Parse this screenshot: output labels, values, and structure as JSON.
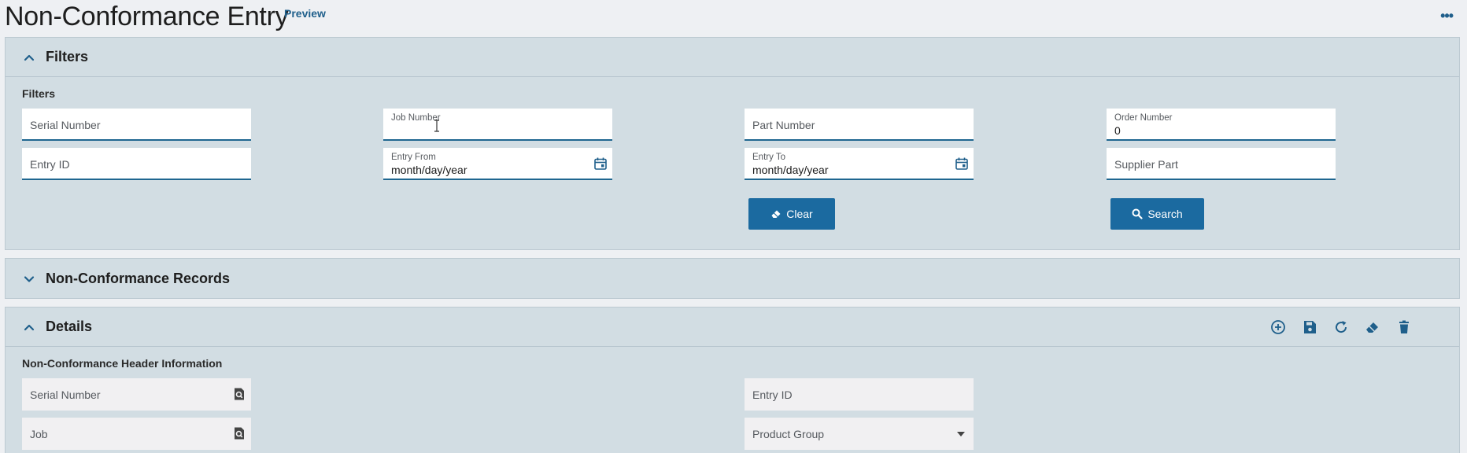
{
  "page": {
    "title": "Non-Conformance Entry",
    "preview_label": "Preview",
    "more_label": "•••"
  },
  "filters_panel": {
    "header": "Filters",
    "section_label": "Filters",
    "fields": {
      "serial_number": {
        "placeholder": "Serial Number"
      },
      "job_number": {
        "label": "Job Number",
        "value": ""
      },
      "part_number": {
        "placeholder": "Part Number"
      },
      "order_number": {
        "label": "Order Number",
        "value": "0"
      },
      "entry_id": {
        "placeholder": "Entry ID"
      },
      "entry_from": {
        "label": "Entry From",
        "value": "month/day/year"
      },
      "entry_to": {
        "label": "Entry To",
        "value": "month/day/year"
      },
      "supplier_part": {
        "placeholder": "Supplier Part"
      }
    },
    "clear_label": "Clear",
    "search_label": "Search"
  },
  "records_panel": {
    "header": "Non-Conformance Records"
  },
  "details_panel": {
    "header": "Details",
    "section_label": "Non-Conformance Header Information",
    "fields": {
      "serial_number": {
        "placeholder": "Serial Number"
      },
      "entry_id": {
        "placeholder": "Entry ID"
      },
      "job": {
        "placeholder": "Job"
      },
      "product_group": {
        "placeholder": "Product Group"
      }
    },
    "tools": [
      "add-icon",
      "save-icon",
      "refresh-icon",
      "eraser-icon",
      "delete-icon"
    ]
  },
  "colors": {
    "accent": "#1b6aa0",
    "panel_bg": "#d2dde3",
    "icon": "#1f5f8b"
  }
}
